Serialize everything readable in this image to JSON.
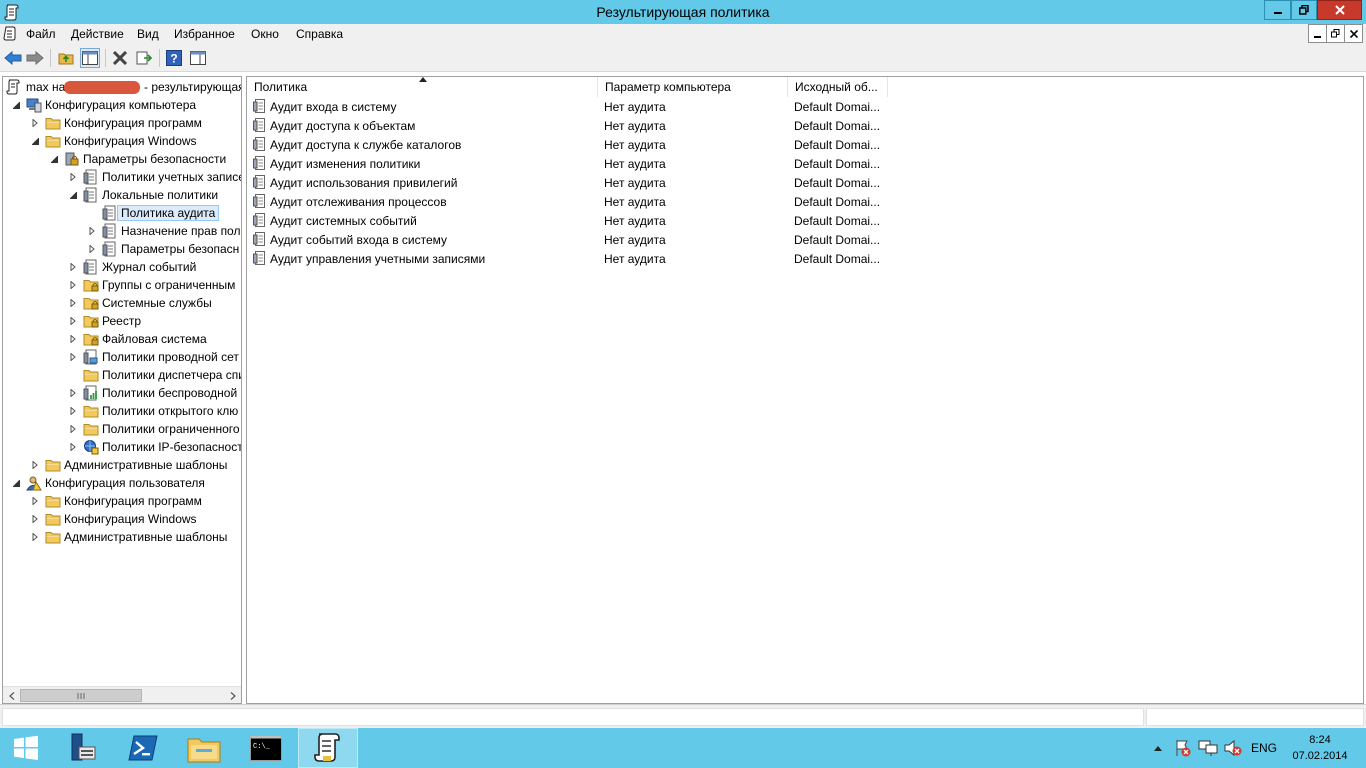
{
  "window": {
    "title": "Результирующая политика"
  },
  "menu": [
    "Файл",
    "Действие",
    "Вид",
    "Избранное",
    "Окно",
    "Справка"
  ],
  "tree": {
    "root_prefix": "max на",
    "root_suffix": "- результирующая",
    "items": [
      {
        "label": "Конфигурация компьютера",
        "level": 0,
        "arrow": "expanded",
        "icon": "computer-config-icon"
      },
      {
        "label": "Конфигурация программ",
        "level": 1,
        "arrow": "collapsed",
        "icon": "folder-icon"
      },
      {
        "label": "Конфигурация Windows",
        "level": 1,
        "arrow": "expanded",
        "icon": "folder-icon"
      },
      {
        "label": "Параметры безопасности",
        "level": 2,
        "arrow": "expanded",
        "icon": "security-settings-icon"
      },
      {
        "label": "Политики учетных записе",
        "level": 3,
        "arrow": "collapsed",
        "icon": "policy-icon"
      },
      {
        "label": "Локальные политики",
        "level": 3,
        "arrow": "expanded",
        "icon": "policy-icon"
      },
      {
        "label": "Политика аудита",
        "level": 4,
        "arrow": "none",
        "icon": "policy-icon",
        "selected": true
      },
      {
        "label": "Назначение прав пол",
        "level": 4,
        "arrow": "collapsed",
        "icon": "policy-icon"
      },
      {
        "label": "Параметры безопасн",
        "level": 4,
        "arrow": "collapsed",
        "icon": "policy-icon"
      },
      {
        "label": "Журнал событий",
        "level": 3,
        "arrow": "collapsed",
        "icon": "policy-icon"
      },
      {
        "label": "Группы с ограниченным",
        "level": 3,
        "arrow": "collapsed",
        "icon": "locked-folder-icon"
      },
      {
        "label": "Системные службы",
        "level": 3,
        "arrow": "collapsed",
        "icon": "locked-folder-icon"
      },
      {
        "label": "Реестр",
        "level": 3,
        "arrow": "collapsed",
        "icon": "locked-folder-icon"
      },
      {
        "label": "Файловая система",
        "level": 3,
        "arrow": "collapsed",
        "icon": "locked-folder-icon"
      },
      {
        "label": "Политики проводной сет",
        "level": 3,
        "arrow": "collapsed",
        "icon": "network-policy-icon"
      },
      {
        "label": "Политики диспетчера спи",
        "level": 3,
        "arrow": "none",
        "icon": "folder-icon"
      },
      {
        "label": "Политики беспроводной",
        "level": 3,
        "arrow": "collapsed",
        "icon": "wireless-policy-icon"
      },
      {
        "label": "Политики открытого клю",
        "level": 3,
        "arrow": "collapsed",
        "icon": "folder-icon"
      },
      {
        "label": "Политики ограниченного",
        "level": 3,
        "arrow": "collapsed",
        "icon": "folder-icon"
      },
      {
        "label": "Политики IP-безопасност",
        "level": 3,
        "arrow": "collapsed",
        "icon": "ip-security-icon"
      },
      {
        "label": "Административные шаблоны",
        "level": 1,
        "arrow": "collapsed",
        "icon": "folder-icon"
      },
      {
        "label": "Конфигурация пользователя",
        "level": 0,
        "arrow": "expanded",
        "icon": "user-config-icon"
      },
      {
        "label": "Конфигурация программ",
        "level": 1,
        "arrow": "collapsed",
        "icon": "folder-icon"
      },
      {
        "label": "Конфигурация Windows",
        "level": 1,
        "arrow": "collapsed",
        "icon": "folder-icon"
      },
      {
        "label": "Административные шаблоны",
        "level": 1,
        "arrow": "collapsed",
        "icon": "folder-icon"
      }
    ]
  },
  "list": {
    "columns": [
      "Политика",
      "Параметр компьютера",
      "Исходный об..."
    ],
    "rows": [
      [
        "Аудит входа в систему",
        "Нет аудита",
        "Default Domai..."
      ],
      [
        "Аудит доступа к объектам",
        "Нет аудита",
        "Default Domai..."
      ],
      [
        "Аудит доступа к службе каталогов",
        "Нет аудита",
        "Default Domai..."
      ],
      [
        "Аудит изменения политики",
        "Нет аудита",
        "Default Domai..."
      ],
      [
        "Аудит использования привилегий",
        "Нет аудита",
        "Default Domai..."
      ],
      [
        "Аудит отслеживания процессов",
        "Нет аудита",
        "Default Domai..."
      ],
      [
        "Аудит системных событий",
        "Нет аудита",
        "Default Domai..."
      ],
      [
        "Аудит событий входа в систему",
        "Нет аудита",
        "Default Domai..."
      ],
      [
        "Аудит управления учетными записями",
        "Нет аудита",
        "Default Domai..."
      ]
    ]
  },
  "taskbar": {
    "language": "ENG",
    "time": "8:24",
    "date": "07.02.2014"
  },
  "colors": {
    "titlebar": "#63c9e9",
    "close": "#c7392a",
    "folder": "#f2c95a",
    "selection": "#dcebfc"
  }
}
